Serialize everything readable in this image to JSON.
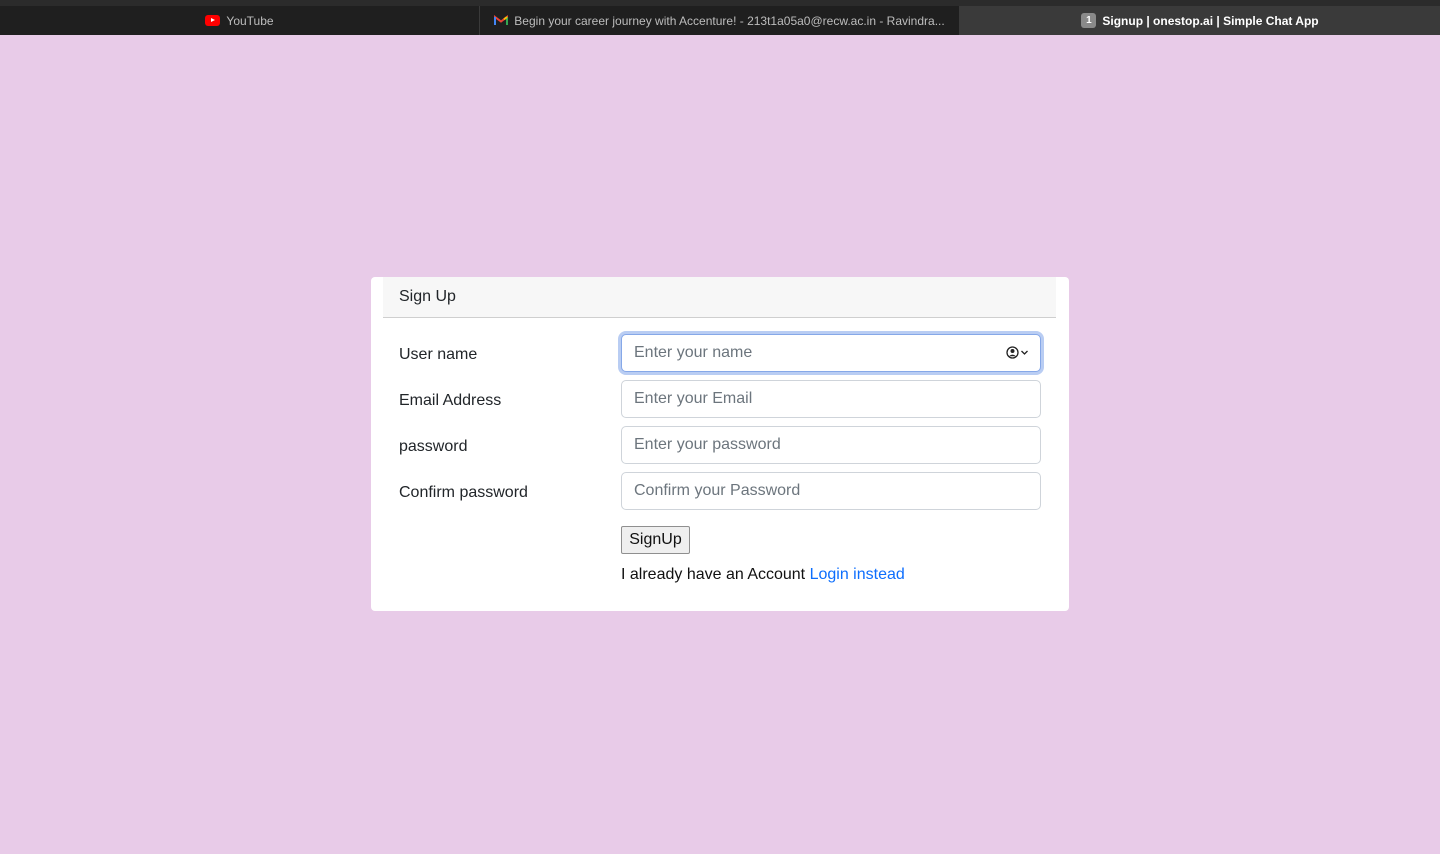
{
  "tabs": [
    {
      "title": "YouTube",
      "icon": "youtube-icon",
      "active": false
    },
    {
      "title": "Begin your career journey with Accenture! - 213t1a05a0@recw.ac.in - Ravindra...",
      "icon": "gmail-icon",
      "active": false
    },
    {
      "title": "Signup | onestop.ai | Simple Chat App",
      "icon": "tab-count-badge",
      "badge": "1",
      "active": true
    }
  ],
  "card": {
    "title": "Sign Up"
  },
  "form": {
    "username": {
      "label": "User name",
      "placeholder": "Enter your name",
      "value": ""
    },
    "email": {
      "label": "Email Address",
      "placeholder": "Enter your Email",
      "value": ""
    },
    "password": {
      "label": "password",
      "placeholder": "Enter your password",
      "value": ""
    },
    "confirm": {
      "label": "Confirm password",
      "placeholder": "Confirm your Password",
      "value": ""
    },
    "submit_label": "SignUp",
    "login_prompt": "I already have an Account",
    "login_link": "Login instead"
  },
  "colors": {
    "page_background": "#e8cbe8",
    "link": "#0d6efd",
    "tab_bar": "#1f1f1f",
    "active_tab": "#3a3a3a"
  }
}
